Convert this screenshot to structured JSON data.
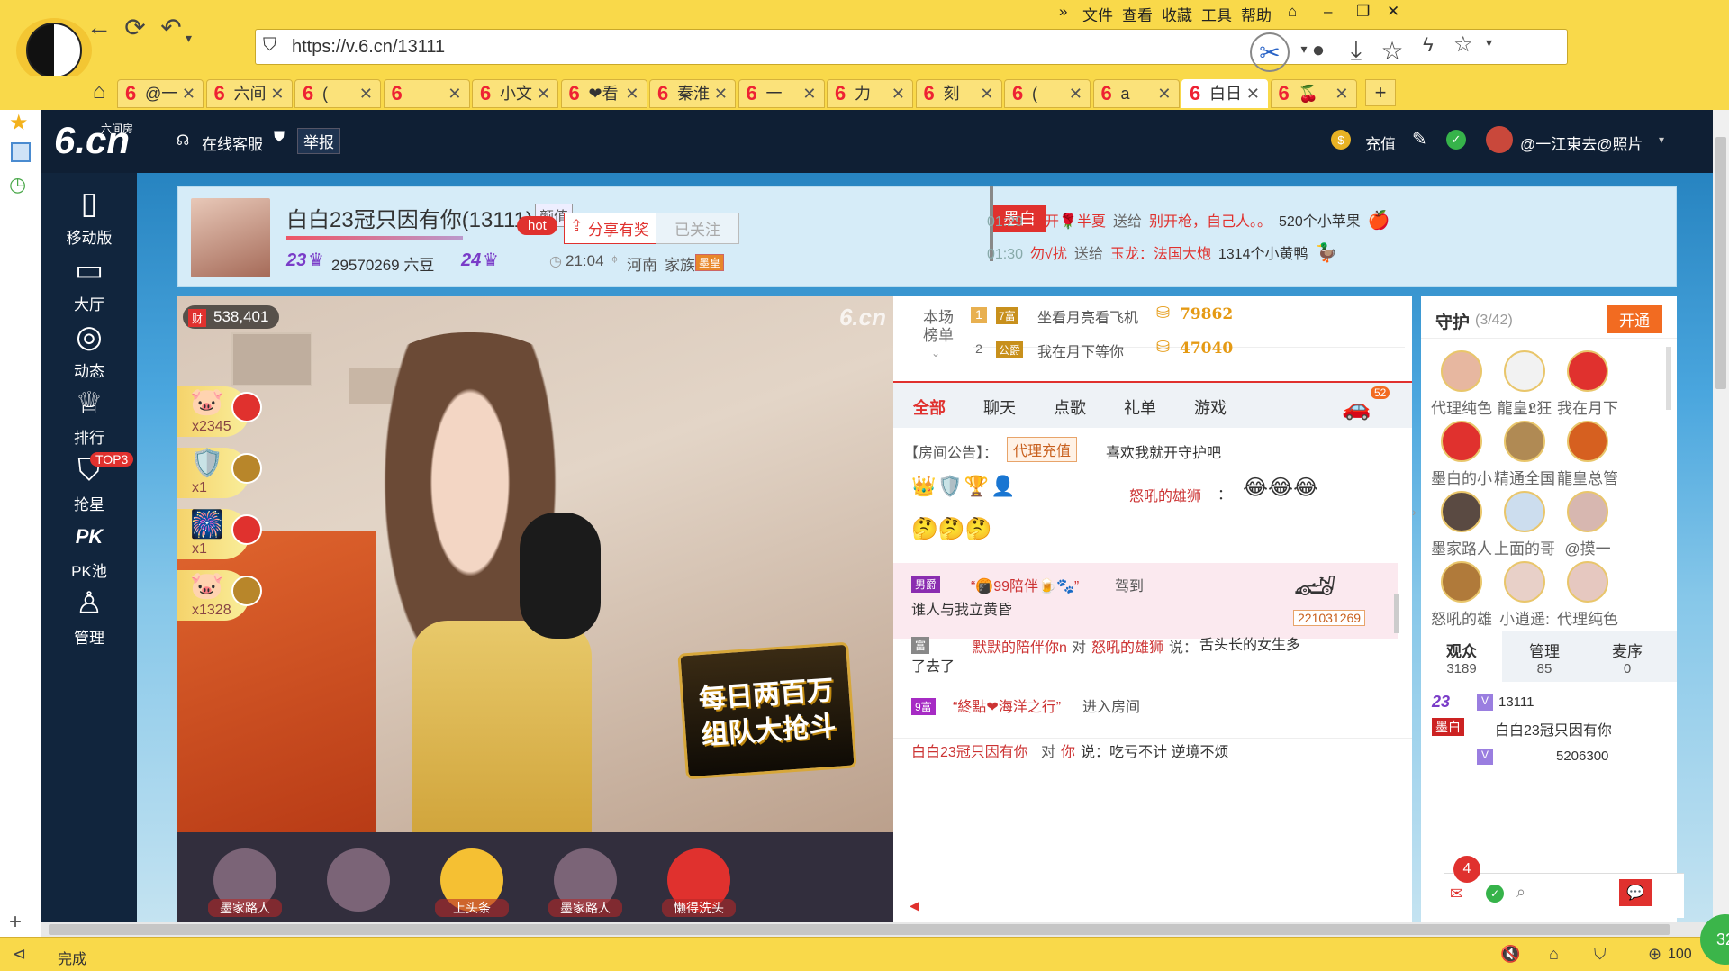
{
  "browser": {
    "menu": [
      "»",
      "文件",
      "查看",
      "收藏",
      "工具",
      "帮助"
    ],
    "url": "https://v.6.cn/13111",
    "tabs": [
      {
        "label": "@一"
      },
      {
        "label": "六间"
      },
      {
        "label": "("
      },
      {
        "label": ""
      },
      {
        "label": "小文"
      },
      {
        "label": "❤看"
      },
      {
        "label": "秦淮"
      },
      {
        "label": "一"
      },
      {
        "label": "力"
      },
      {
        "label": "刻"
      },
      {
        "label": "("
      },
      {
        "label": "a"
      },
      {
        "label": "白日"
      },
      {
        "label": "🍒"
      }
    ],
    "status": "完成",
    "zoom": "100",
    "corner_badge": "32"
  },
  "site": {
    "logo_text": "6.cn",
    "logo_sub": "六间房",
    "service": "在线客服",
    "report": "举报",
    "recharge": "充值",
    "username": "@一江東去@照片",
    "sidenav": [
      {
        "icon": "phone-icon",
        "label": "移动版"
      },
      {
        "icon": "tv-icon",
        "label": "大厅"
      },
      {
        "icon": "compass-icon",
        "label": "动态"
      },
      {
        "icon": "crown-icon",
        "label": "排行"
      },
      {
        "icon": "basket-icon",
        "label": "抢星",
        "badge": "TOP3"
      },
      {
        "icon": "pk-icon",
        "label": "PK池"
      },
      {
        "icon": "manage-icon",
        "label": "管理"
      }
    ]
  },
  "room": {
    "title": "白白23冠只因有你(13111)",
    "tag": "颜值",
    "level": "23",
    "beans": "29570269 六豆",
    "level2": "24",
    "hot": "hot",
    "share": "分享有奖",
    "follow": "已关注",
    "time": "21:04",
    "location": "河南",
    "family": "家族",
    "family_badge": "墨皇",
    "flag": "墨白",
    "gift_msgs": [
      {
        "time": "01:29",
        "from": "花开🌹半夏",
        "verb": "送给",
        "to": "别开枪，自己人。。",
        "gift": "520个小苹果"
      },
      {
        "time": "01:30",
        "from": "勿√扰",
        "verb": "送给",
        "to": "玉龙：法国大炮",
        "gift": "1314个小黄鸭"
      }
    ]
  },
  "video": {
    "wealth": "538,401",
    "gifts": [
      {
        "count": "x2345"
      },
      {
        "count": "x1"
      },
      {
        "count": "x1"
      },
      {
        "count": "x1328"
      }
    ],
    "promo_line1": "每日两百万",
    "promo_line2": "组队大抢斗",
    "bottom_labels": [
      "墨家路人",
      "",
      "上头条",
      "墨家路人",
      "懒得洗头"
    ]
  },
  "chat": {
    "ranking_label": "本场榜单",
    "rank": [
      {
        "no": "1",
        "badge": "7富",
        "name": "坐看月亮看飞机",
        "score": "79862"
      },
      {
        "no": "2",
        "badge": "公爵",
        "name": "我在月下等你",
        "score": "47040"
      }
    ],
    "tabs": [
      "全部",
      "聊天",
      "点歌",
      "礼单",
      "游戏"
    ],
    "car_badge": "52",
    "notice_prefix": "【房间公告】：",
    "notice_tag": "代理充值",
    "notice_text": "喜欢我就开守护吧",
    "msg1_user": "怒吼的雄狮",
    "enter_badge": "男爵",
    "enter_user": "“🍘99陪伴🍺🐾”",
    "enter_verb": "驾到",
    "enter_sub": "谁人与我立黄昏",
    "car_id": "221031269",
    "msg3_user": "默默的陪伴你n",
    "msg3_to": "怒吼的雄狮",
    "msg3_text": "舌头长的女生多了去了",
    "msg4_user": "“終點❤海洋之行”",
    "msg4_verb": "进入房间",
    "msg5_user": "白白23冠只因有你",
    "msg5_mid": "对",
    "msg5_to": "你",
    "msg5_text": "说：吃亏不计 逆境不烦",
    "say": "说：",
    "to_word": "对"
  },
  "guard": {
    "title": "守护",
    "count": "(3/42)",
    "open": "开通",
    "members": [
      "代理纯色",
      "龍皇𝕷狂",
      "我在月下",
      "墨白的小",
      "精通全国",
      "龍皇总管",
      "墨家路人",
      "上面的哥",
      "@摸一",
      "怒吼的雄",
      "小逍遥:",
      "代理纯色"
    ],
    "tabs": [
      {
        "label": "观众",
        "count": "3189"
      },
      {
        "label": "管理",
        "count": "85"
      },
      {
        "label": "麦序",
        "count": "0"
      }
    ],
    "audience": [
      {
        "level": "23",
        "id": "13111",
        "flag": "墨白",
        "name": "白白23冠只因有你"
      },
      {
        "level": "",
        "id": "5206300",
        "flag": "",
        "name": ""
      }
    ],
    "bubble": "4"
  }
}
